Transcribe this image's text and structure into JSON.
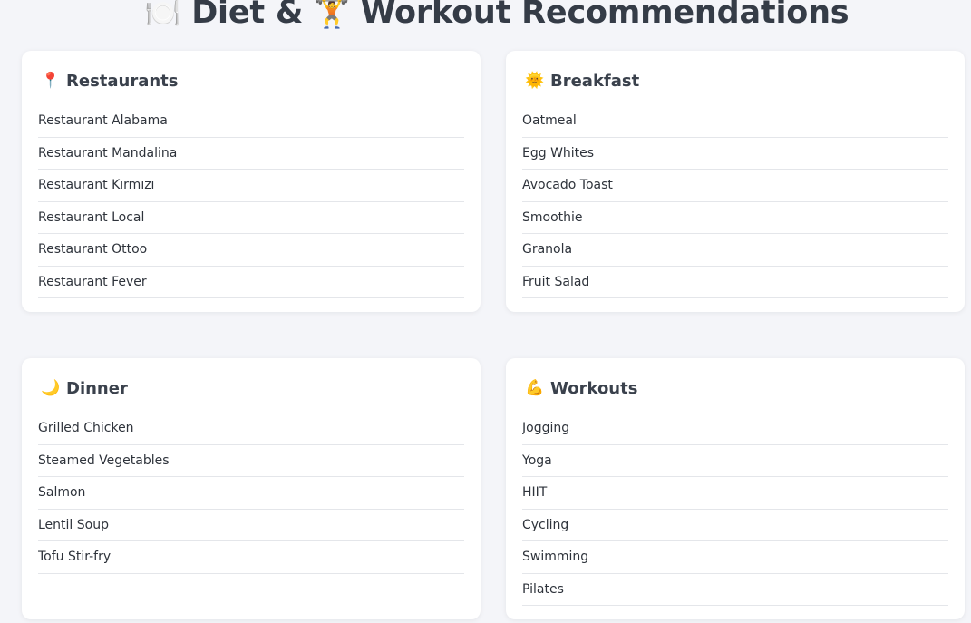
{
  "title": {
    "emoji_left": "🍽️",
    "text_left": "Diet &",
    "emoji_mid": "🏋️",
    "text_right": "Workout Recommendations"
  },
  "sections": {
    "restaurants": {
      "icon": "📍",
      "icon_name": "pin-icon",
      "title": "Restaurants",
      "items": [
        "Restaurant Alabama",
        "Restaurant Mandalina",
        "Restaurant Kırmızı",
        "Restaurant Local",
        "Restaurant Ottoo",
        "Restaurant Fever"
      ]
    },
    "breakfast": {
      "icon": "🌞",
      "icon_name": "sun-icon",
      "title": "Breakfast",
      "items": [
        "Oatmeal",
        "Egg Whites",
        "Avocado Toast",
        "Smoothie",
        "Granola",
        "Fruit Salad"
      ]
    },
    "dinner": {
      "icon": "🌙",
      "icon_name": "moon-icon",
      "title": "Dinner",
      "items": [
        "Grilled Chicken",
        "Steamed Vegetables",
        "Salmon",
        "Lentil Soup",
        "Tofu Stir-fry"
      ]
    },
    "workouts": {
      "icon": "💪",
      "icon_name": "flexed-biceps-icon",
      "title": "Workouts",
      "items": [
        "Jogging",
        "Yoga",
        "HIIT",
        "Cycling",
        "Swimming",
        "Pilates"
      ]
    }
  }
}
